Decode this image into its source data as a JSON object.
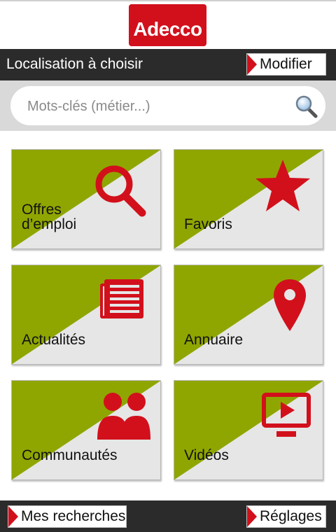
{
  "header": {
    "logo_text": "Adecco"
  },
  "location": {
    "label": "Localisation à choisir",
    "modify_label": "Modifier"
  },
  "search": {
    "placeholder": "Mots-clés (métier...)"
  },
  "tiles": [
    {
      "label_line1": "Offres",
      "label_line2": "d’emploi",
      "icon": "magnifier-icon"
    },
    {
      "label_line1": "Favoris",
      "icon": "star-icon"
    },
    {
      "label_line1": "Actualités",
      "icon": "newspaper-icon"
    },
    {
      "label_line1": "Annuaire",
      "icon": "map-pin-icon"
    },
    {
      "label_line1": "Communautés",
      "icon": "people-icon"
    },
    {
      "label_line1": "Vidéos",
      "icon": "video-icon"
    }
  ],
  "bottom": {
    "searches_label": "Mes recherches",
    "settings_label": "Réglages"
  },
  "colors": {
    "brand_red": "#d2101c",
    "tile_green": "#8fa600",
    "bar_dark": "#2b2b2b"
  }
}
